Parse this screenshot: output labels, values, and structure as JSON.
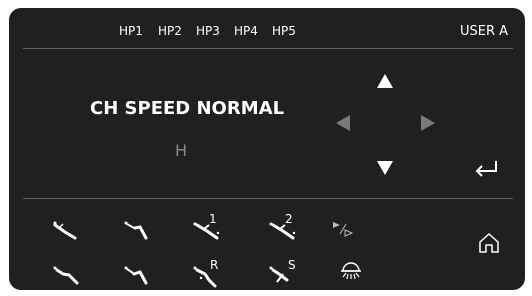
{
  "header": {
    "presets": [
      "HP1",
      "HP2",
      "HP3",
      "HP4",
      "HP5"
    ],
    "user": "USER A"
  },
  "main": {
    "mode_label": "CH SPEED NORMAL",
    "level": "H"
  },
  "nav": {
    "up_icon": "arrow-up-icon",
    "down_icon": "arrow-down-icon",
    "left_icon": "arrow-left-icon",
    "right_icon": "arrow-right-icon",
    "enter_icon": "enter-return-icon"
  },
  "buttons": {
    "row1": [
      {
        "icon": "handpiece-1-icon",
        "label": ""
      },
      {
        "icon": "handpiece-2-icon",
        "label": ""
      },
      {
        "icon": "handpiece-3-icon",
        "label": "1"
      },
      {
        "icon": "handpiece-4-icon",
        "label": "2"
      },
      {
        "icon": "step-play-icon",
        "label": ""
      }
    ],
    "row2": [
      {
        "icon": "handpiece-5-icon",
        "label": ""
      },
      {
        "icon": "handpiece-6-icon",
        "label": ""
      },
      {
        "icon": "handpiece-7-icon",
        "label": "R"
      },
      {
        "icon": "handpiece-8-icon",
        "label": "S"
      },
      {
        "icon": "light-icon",
        "label": ""
      }
    ],
    "home_icon": "home-icon"
  },
  "colors": {
    "panel": "#202020",
    "text": "#ffffff",
    "dim": "#8a8a8a",
    "divider": "#5e5e5e"
  }
}
